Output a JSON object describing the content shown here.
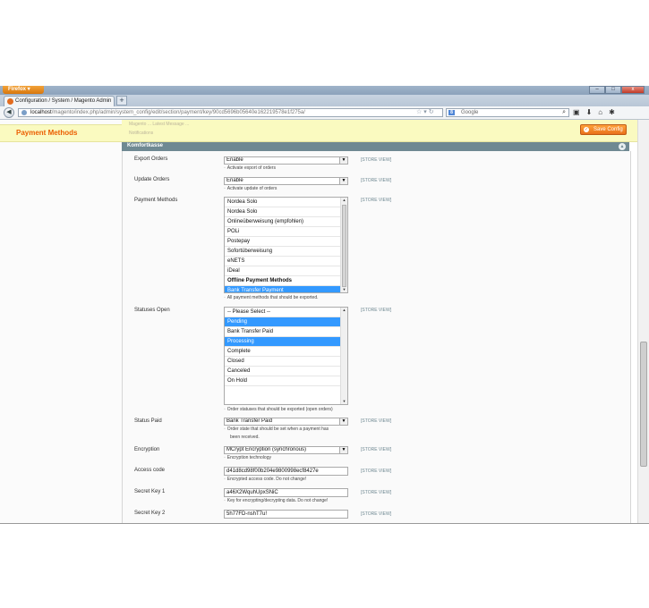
{
  "browser": {
    "menu_button": "Firefox",
    "tab_title": "Configuration / System / Magento Admin",
    "new_tab": "+",
    "url_host": "localhost",
    "url_path": "/magento/index.php/admin/system_config/edit/section/payment/key/90cd5696b05640e162219578e1f275a/",
    "search_engine": "Google",
    "window_min": "–",
    "window_max": "□",
    "window_close": "x"
  },
  "admin": {
    "left_section_title": "Payment Methods",
    "message_line_1": "Magento ... Latest Message ...",
    "message_line_2": "Notifications",
    "save_button": "Save Config",
    "section_title": "Komfortkasse"
  },
  "form": {
    "scope_label": "[STORE VIEW]",
    "export_orders": {
      "label": "Export Orders",
      "value": "Enable",
      "hint": "Activate export of orders"
    },
    "update_orders": {
      "label": "Update Orders",
      "value": "Enable",
      "hint": "Activate update of orders"
    },
    "payment_methods": {
      "label": "Payment Methods",
      "options": [
        {
          "text": "Nordea Solo",
          "selected": false,
          "group": false
        },
        {
          "text": "Nordea Solo",
          "selected": false,
          "group": false
        },
        {
          "text": "Onlineüberweisung (empfohlen)",
          "selected": false,
          "group": false
        },
        {
          "text": "POLi",
          "selected": false,
          "group": false
        },
        {
          "text": "Postepay",
          "selected": false,
          "group": false
        },
        {
          "text": "Sofortüberweisung",
          "selected": false,
          "group": false
        },
        {
          "text": "eNETS",
          "selected": false,
          "group": false
        },
        {
          "text": "iDeal",
          "selected": false,
          "group": false
        },
        {
          "text": "Offline Payment Methods",
          "selected": false,
          "group": true
        },
        {
          "text": "Bank Transfer Payment",
          "selected": true,
          "group": false
        }
      ],
      "hint": "All payment methods that should be exported."
    },
    "statuses_open": {
      "label": "Statuses Open",
      "options": [
        {
          "text": "-- Please Select --",
          "selected": false
        },
        {
          "text": "Pending",
          "selected": true
        },
        {
          "text": "Bank Transfer Paid",
          "selected": false
        },
        {
          "text": "Processing",
          "selected": true
        },
        {
          "text": "Complete",
          "selected": false
        },
        {
          "text": "Closed",
          "selected": false
        },
        {
          "text": "Canceled",
          "selected": false
        },
        {
          "text": "On Hold",
          "selected": false
        }
      ],
      "hint": "Order statuses that should be exported (open orders)"
    },
    "status_paid": {
      "label": "Status Paid",
      "value": "Bank Transfer Paid",
      "hint_line_1": "Order state that should be set when a payment has",
      "hint_line_2": "been received."
    },
    "encryption": {
      "label": "Encryption",
      "value": "MCrypt Encryption (synchronous)",
      "hint": "Encryption technology"
    },
    "access_code": {
      "label": "Access code",
      "value": "d41d8cd98f00b204e9800998ecf8427e",
      "hint": "Encrypted access code. Do not change!"
    },
    "secret_key_1": {
      "label": "Secret Key 1",
      "value": "a46X2WquhUpxSNiC",
      "hint": "Key for encrypting/decrypting data. Do not change!"
    },
    "secret_key_2": {
      "label": "Secret Key 2",
      "value": "5h77FD-nshT7u!"
    }
  }
}
